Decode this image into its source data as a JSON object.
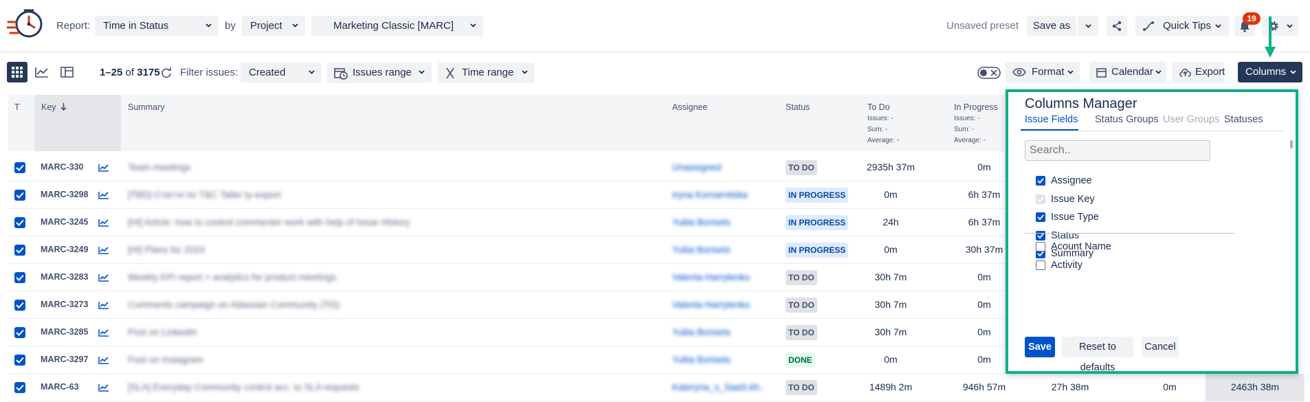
{
  "header": {
    "report_label": "Report:",
    "report_value": "Time in Status",
    "by_label": "by",
    "groupby_value": "Project",
    "project_value": "Marketing Classic [MARC]",
    "unsaved_preset": "Unsaved preset",
    "save_as": "Save as",
    "quick_tips": "Quick Tips",
    "notifications_count": "19"
  },
  "toolbar": {
    "range_bold": "1–25",
    "range_of": "of",
    "range_total": "3175",
    "filter_label": "Filter issues:",
    "filter_value": "Created",
    "issues_range": "Issues range",
    "time_range": "Time range",
    "format": "Format",
    "calendar": "Calendar",
    "export": "Export",
    "columns": "Columns"
  },
  "table": {
    "headers": {
      "t": "T",
      "key": "Key",
      "summary": "Summary",
      "assignee": "Assignee",
      "status": "Status",
      "todo": "To Do",
      "in_progress": "In Progress"
    },
    "stat_labels": {
      "issues": "Issues: -",
      "sum": "Sum: -",
      "average": "Average: -"
    },
    "rows": [
      {
        "key": "MARC-330",
        "summary": "Team meetings",
        "assignee": "Unassigned",
        "status": "TO DO",
        "todo": "2935h 37m",
        "inprog": "0m"
      },
      {
        "key": "MARC-3298",
        "summary": "[TBD] Статти по T&C Tailer ty-export",
        "assignee": "Iryna Kornarnitska",
        "status": "IN PROGRESS",
        "todo": "0m",
        "inprog": "6h 37m"
      },
      {
        "key": "MARC-3245",
        "summary": "[HI] Article: how to control commenter work with help of Issue History",
        "assignee": "Yuliia Borisets",
        "status": "IN PROGRESS",
        "todo": "24h",
        "inprog": "6h 37m"
      },
      {
        "key": "MARC-3249",
        "summary": "[HI] Plans for 2024",
        "assignee": "Yuliia Borisets",
        "status": "IN PROGRESS",
        "todo": "0m",
        "inprog": "30h 37m"
      },
      {
        "key": "MARC-3283",
        "summary": "Weekly KPI report + analytics for product meetings",
        "assignee": "Valeriia Harrylenko",
        "status": "TO DO",
        "todo": "30h 7m",
        "inprog": "0m"
      },
      {
        "key": "MARC-3273",
        "summary": "Comments campaign on Atlassian Community (TiS)",
        "assignee": "Valeriia Harrylenko",
        "status": "TO DO",
        "todo": "30h 7m",
        "inprog": "0m"
      },
      {
        "key": "MARC-3285",
        "summary": "Post on LinkedIn",
        "assignee": "Yuliia Borisets",
        "status": "TO DO",
        "todo": "30h 7m",
        "inprog": "0m"
      },
      {
        "key": "MARC-3297",
        "summary": "Post on Instagram",
        "assignee": "Yuliia Borisets",
        "status": "DONE",
        "todo": "0m",
        "inprog": "0m"
      },
      {
        "key": "MARC-63",
        "summary": "[SLA] Everyday Community control acc. to SLA requests",
        "assignee": "Kateryna_s_SaaS.kh..",
        "status": "TO DO",
        "todo": "1489h 2m",
        "inprog": "946h 57m",
        "extra1": "27h 38m",
        "extra2": "0m",
        "extra3": "2463h 38m"
      }
    ]
  },
  "columns_manager": {
    "title": "Columns Manager",
    "tabs": [
      "Issue Fields",
      "Status Groups",
      "User Groups",
      "Statuses"
    ],
    "search_placeholder": "Search..",
    "fields_selected": [
      "Assignee",
      "Issue Key",
      "Issue Type",
      "Status",
      "Summary"
    ],
    "fields_available": [
      "Acount Name",
      "Activity"
    ],
    "save": "Save",
    "reset": "Reset to defaults",
    "cancel": "Cancel"
  },
  "colors": {
    "accent": "#0052cc",
    "dark_button": "#253858",
    "highlight_border": "#0fae8a",
    "badge": "#de350b"
  }
}
